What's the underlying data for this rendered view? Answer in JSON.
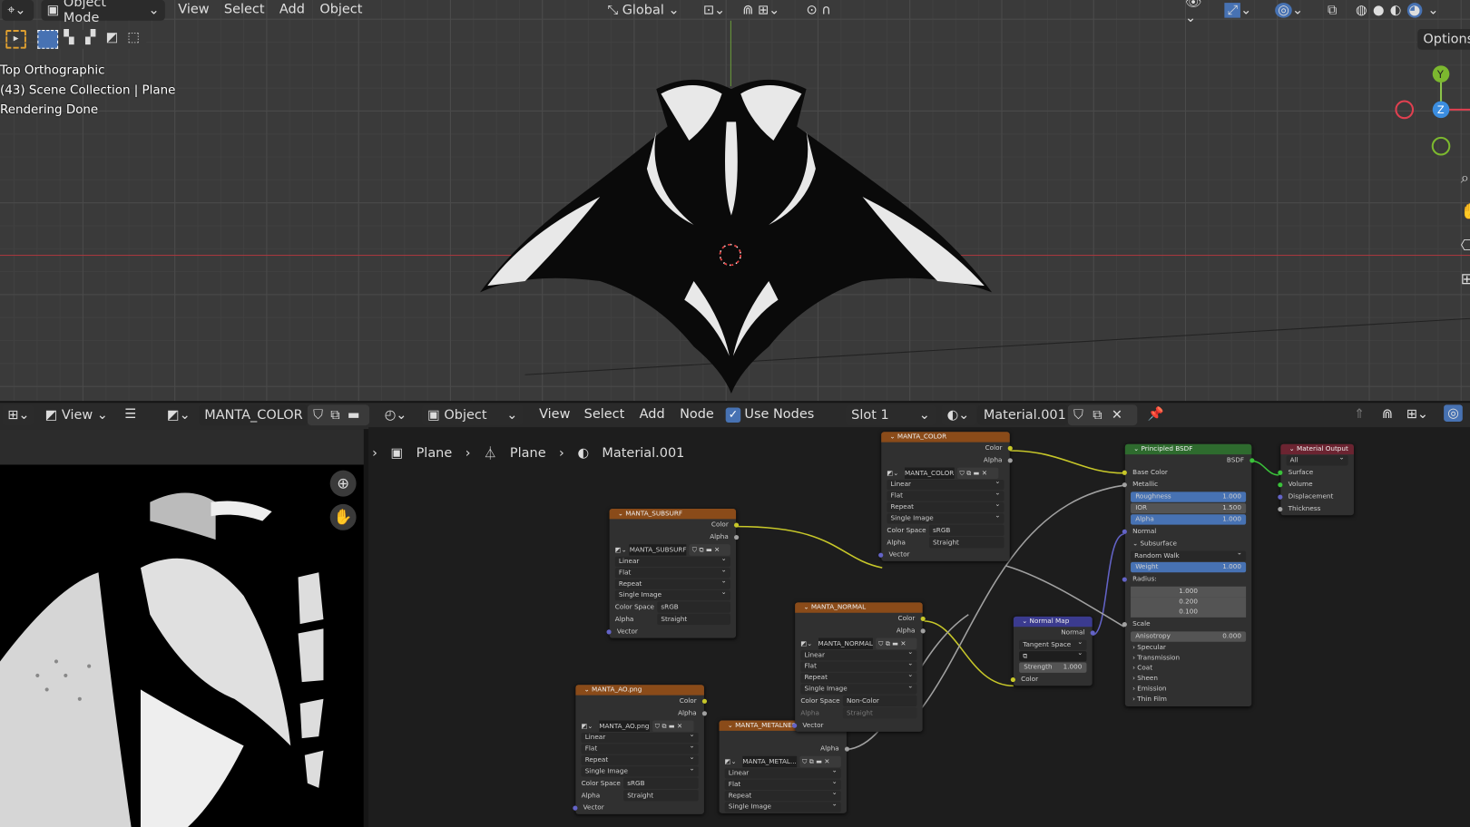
{
  "viewport": {
    "mode": "Object Mode",
    "menus": [
      "View",
      "Select",
      "Add",
      "Object"
    ],
    "transform_orientation": "Global",
    "options_label": "Options",
    "overlay_lines": [
      "Top Orthographic",
      "(43) Scene Collection | Plane",
      "Rendering Done"
    ],
    "gizmo": {
      "y": "Y",
      "z": "Z"
    }
  },
  "image_editor": {
    "view_label": "View",
    "image_name": "MANTA_COLOR"
  },
  "node_editor": {
    "type_label": "Object",
    "menus": [
      "View",
      "Select",
      "Add",
      "Node"
    ],
    "use_nodes_label": "Use Nodes",
    "use_nodes": true,
    "slot": "Slot 1",
    "material": "Material.001",
    "breadcrumb": [
      "Plane",
      "Plane",
      "Material.001"
    ]
  },
  "nodes": [
    {
      "title": "MANTA_COLOR",
      "color": "#8a4b19",
      "outputs": [
        "Color",
        "Alpha"
      ],
      "image": "MANTA_COLOR",
      "dropdowns": [
        "Linear",
        "Flat",
        "Repeat",
        "Single Image"
      ],
      "props": [
        [
          "Color Space",
          "sRGB"
        ],
        [
          "Alpha",
          "Straight"
        ]
      ],
      "inputs": [
        "Vector"
      ]
    },
    {
      "title": "MANTA_SUBSURF",
      "color": "#8a4b19",
      "outputs": [
        "Color",
        "Alpha"
      ],
      "image": "MANTA_SUBSURF",
      "dropdowns": [
        "Linear",
        "Flat",
        "Repeat",
        "Single Image"
      ],
      "props": [
        [
          "Color Space",
          "sRGB"
        ],
        [
          "Alpha",
          "Straight"
        ]
      ],
      "inputs": [
        "Vector"
      ]
    },
    {
      "title": "MANTA_NORMAL",
      "color": "#8a4b19",
      "outputs": [
        "Color",
        "Alpha"
      ],
      "image": "MANTA_NORMAL",
      "dropdowns": [
        "Linear",
        "Flat",
        "Repeat",
        "Single Image"
      ],
      "props": [
        [
          "Color Space",
          "Non-Color"
        ],
        [
          "Alpha",
          "Straight"
        ]
      ],
      "inputs": [
        "Vector"
      ]
    },
    {
      "title": "MANTA_AO.png",
      "color": "#8a4b19",
      "outputs": [
        "Color",
        "Alpha"
      ],
      "image": "MANTA_AO.png",
      "dropdowns": [
        "Linear",
        "Flat",
        "Repeat",
        "Single Image"
      ],
      "props": [
        [
          "Color Space",
          "sRGB"
        ],
        [
          "Alpha",
          "Straight"
        ]
      ],
      "inputs": [
        "Vector"
      ]
    },
    {
      "title": "MANTA_METALNESS.",
      "color": "#8a4b19",
      "outputs": [
        "",
        "Alpha"
      ],
      "image": "MANTA_METAL...",
      "dropdowns": [
        "Linear",
        "Flat",
        "Repeat",
        "Single Image"
      ],
      "props": [],
      "inputs": []
    }
  ],
  "normal_map": {
    "title": "Normal Map",
    "output": "Normal",
    "space": "Tangent Space",
    "strength_label": "Strength",
    "strength": "1.000",
    "input": "Color"
  },
  "bsdf": {
    "title": "Principled BSDF",
    "output": "BSDF",
    "inputs": [
      "Base Color",
      "Metallic"
    ],
    "sliders": [
      [
        "Roughness",
        "1.000",
        true
      ],
      [
        "IOR",
        "1.500",
        false
      ],
      [
        "Alpha",
        "1.000",
        true
      ]
    ],
    "normal": "Normal",
    "subsurface": "Subsurface",
    "method": "Random Walk",
    "weight": [
      "Weight",
      "1.000"
    ],
    "radius_label": "Radius:",
    "radius": [
      "1.000",
      "0.200",
      "0.100"
    ],
    "scale": "Scale",
    "anisotropy": [
      "Anisotropy",
      "0.000"
    ],
    "panels": [
      "Specular",
      "Transmission",
      "Coat",
      "Sheen",
      "Emission",
      "Thin Film"
    ]
  },
  "material_output": {
    "title": "Material Output",
    "target": "All",
    "inputs": [
      "Surface",
      "Volume",
      "Displacement",
      "Thickness"
    ]
  },
  "colors": {
    "accent": "#4772b3",
    "image_node": "#8a4b19",
    "vector_node": "#3b3b8f",
    "shader_node": "#2e6b2e",
    "output_node": "#6b2431"
  }
}
